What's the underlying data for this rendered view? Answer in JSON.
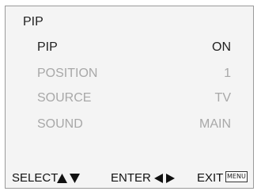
{
  "menu": {
    "title": "PIP",
    "items": [
      {
        "label": "PIP",
        "value": "ON",
        "state": "active"
      },
      {
        "label": "POSITION",
        "value": "1",
        "state": "dim"
      },
      {
        "label": "SOURCE",
        "value": "TV",
        "state": "dim"
      },
      {
        "label": "SOUND",
        "value": "MAIN",
        "state": "dim"
      }
    ]
  },
  "footer": {
    "select_label": "SELECT",
    "select_icon": "up-down-arrows-icon",
    "enter_label": "ENTER",
    "enter_icon": "left-right-arrows-icon",
    "exit_label": "EXIT",
    "exit_key_label": "MENU"
  },
  "colors": {
    "text_active": "#222222",
    "text_dim": "#a8a8a8",
    "panel_bg": "#f4f4f4"
  }
}
